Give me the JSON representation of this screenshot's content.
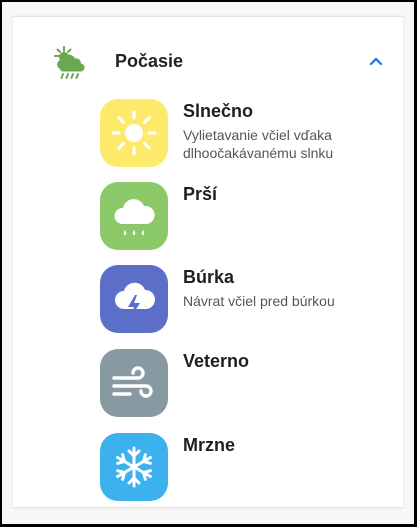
{
  "section": {
    "title": "Počasie",
    "icon": "sun-behind-rain-cloud-icon",
    "expanded_icon": "chevron-up-icon",
    "accent": "#1a73e8",
    "icon_color": "#6aa84f"
  },
  "items": [
    {
      "title": "Slnečno",
      "subtitle": "Vylietavanie včiel vďaka dlhoočakávanému slnku",
      "icon": "sun-icon",
      "color": "#fde96a"
    },
    {
      "title": "Prší",
      "subtitle": "",
      "icon": "rain-cloud-icon",
      "color": "#8bc86a"
    },
    {
      "title": "Búrka",
      "subtitle": "Návrat včiel pred búrkou",
      "icon": "storm-cloud-icon",
      "color": "#5b6fc9"
    },
    {
      "title": "Veterno",
      "subtitle": "",
      "icon": "wind-icon",
      "color": "#879aa2"
    },
    {
      "title": "Mrzne",
      "subtitle": "",
      "icon": "snowflake-icon",
      "color": "#3db1ee"
    }
  ]
}
